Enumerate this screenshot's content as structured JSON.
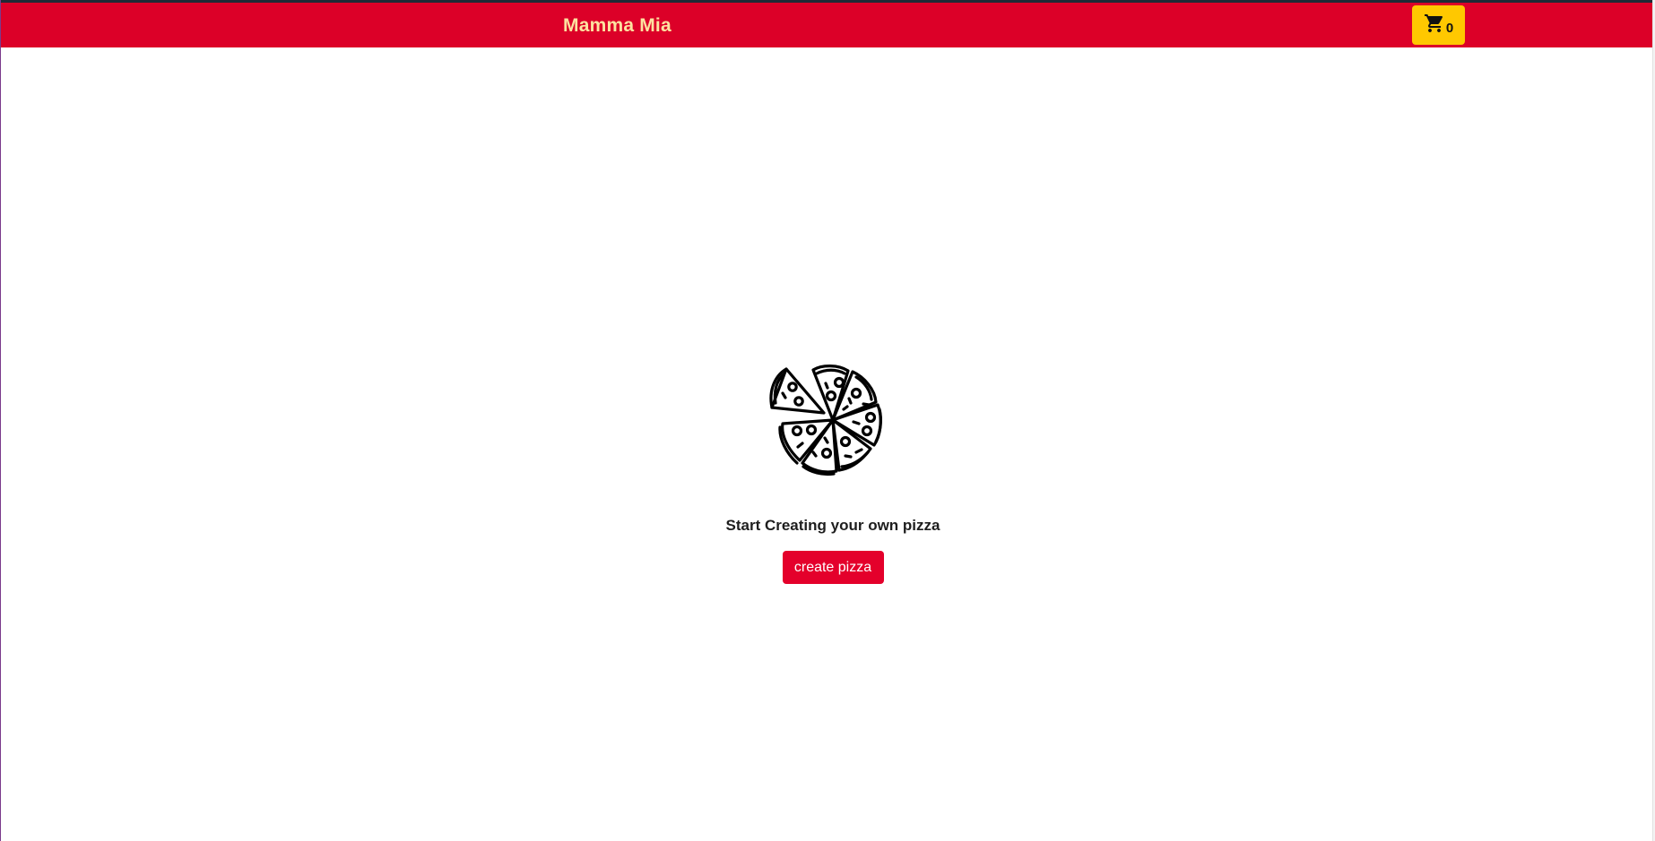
{
  "header": {
    "brand": "Mamma Mia",
    "cart_count": "0",
    "cart_icon": "cart-icon"
  },
  "main": {
    "empty_icon": "pizza-icon",
    "message": "Start Creating your own pizza",
    "create_button_label": "create pizza"
  },
  "colors": {
    "navbar": "#dc0028",
    "brand_text": "#fde2a0",
    "cart_button": "#ffc800",
    "primary_button": "#e4002b"
  }
}
